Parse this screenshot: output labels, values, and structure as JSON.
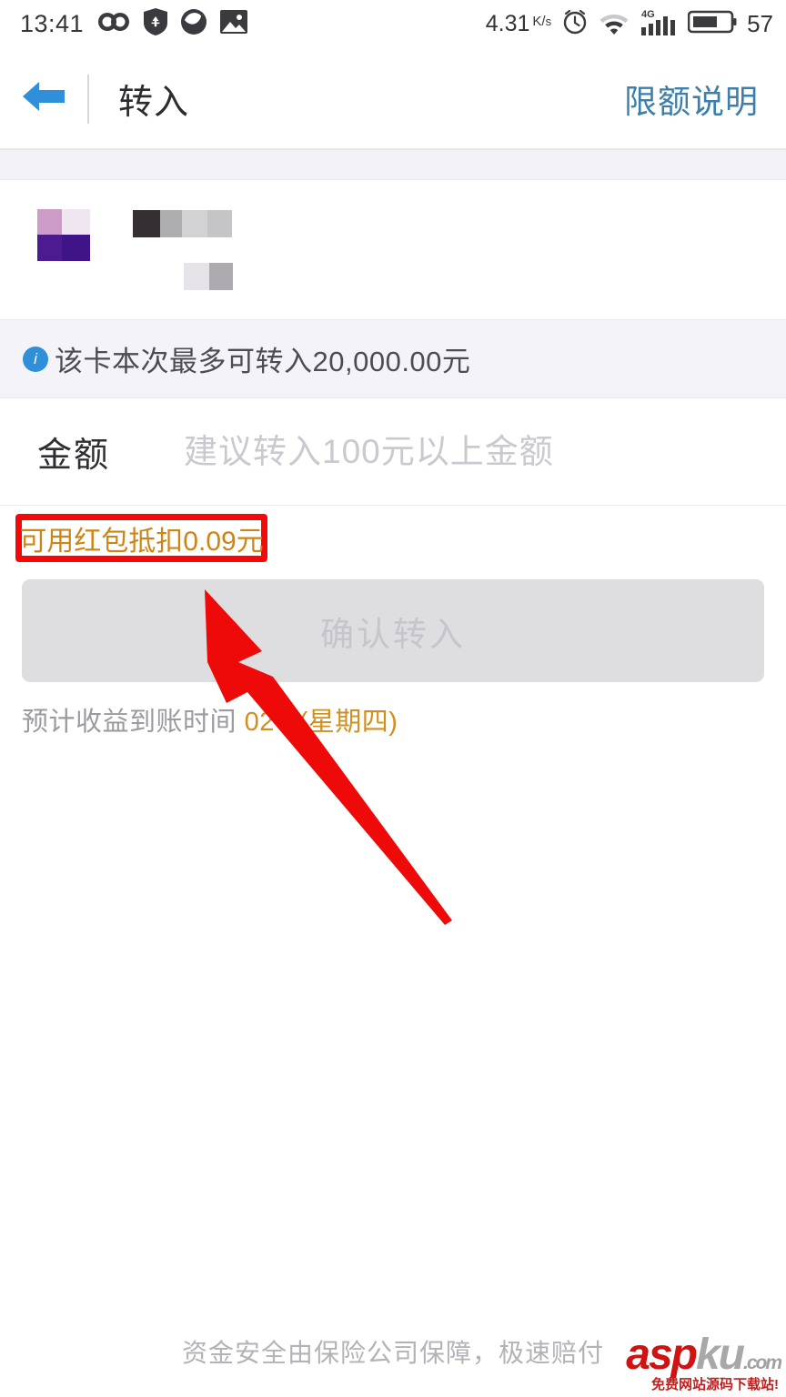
{
  "status_bar": {
    "time": "13:41",
    "network_speed": "4.31",
    "network_unit_top": "K",
    "network_unit_bottom": "s",
    "battery_level": "57",
    "signal_label": "4G",
    "icons": [
      "infinity-icon",
      "yen-shield-icon",
      "moon-circle-icon",
      "gallery-icon",
      "alarm-clock-icon",
      "wifi-icon",
      "signal-bars-icon",
      "battery-icon"
    ]
  },
  "header": {
    "back_icon": "back-arrow-icon",
    "title": "转入",
    "action_label": "限额说明",
    "accent_color": "#3d7fab"
  },
  "card": {
    "icon_name": "bank-card-icon-redacted",
    "name_redacted": true,
    "number_redacted": true
  },
  "info": {
    "icon_glyph": "i",
    "icon_color": "#2f8fd8",
    "text": "该卡本次最多可转入20,000.00元"
  },
  "amount": {
    "label": "金额",
    "value": "",
    "placeholder": "建议转入100元以上金额"
  },
  "annotation": {
    "redbox_text": "可用红包抵扣0.09元",
    "redbox_border_color": "#f40808",
    "redbox_text_color": "#cf8415",
    "arrow_color": "#ef0a0a",
    "arrow_name": "red-pointer-arrow"
  },
  "confirm": {
    "label": "确认转入",
    "disabled": true
  },
  "eta": {
    "prefix": "预计收益到账时间 ",
    "date": "02-1",
    "weekday": "(星期四)",
    "date_color": "#d09020"
  },
  "footer": {
    "text": "资金安全由保险公司保障，极速赔付"
  },
  "watermark": {
    "part_red": "asp",
    "part_gray": "ku",
    "part_com": ".com",
    "sub_text": "免费网站源码下载站!"
  }
}
